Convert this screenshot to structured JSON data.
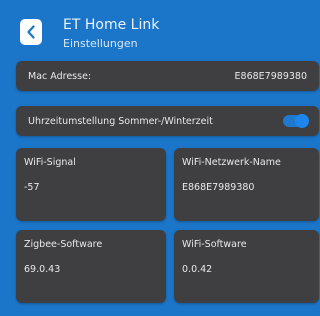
{
  "header": {
    "title": "ET Home Link",
    "subtitle": "Einstellungen",
    "back_icon": "chevron-left-icon"
  },
  "mac": {
    "label": "Mac Adresse:",
    "value": "E868E7989380"
  },
  "dst": {
    "label": "Uhrzeitumstellung Sommer-/Winterzeit",
    "enabled": true
  },
  "tiles": [
    {
      "label": "WiFi-Signal",
      "value": "-57"
    },
    {
      "label": "WiFi-Netzwerk-Name",
      "value": "E868E7989380"
    },
    {
      "label": "Zigbee-Software",
      "value": "69.0.43"
    },
    {
      "label": "WiFi-Software",
      "value": "0.0.42"
    }
  ],
  "colors": {
    "background": "#1b75c8",
    "card": "#3f3f41",
    "accent": "#1c86ee"
  }
}
